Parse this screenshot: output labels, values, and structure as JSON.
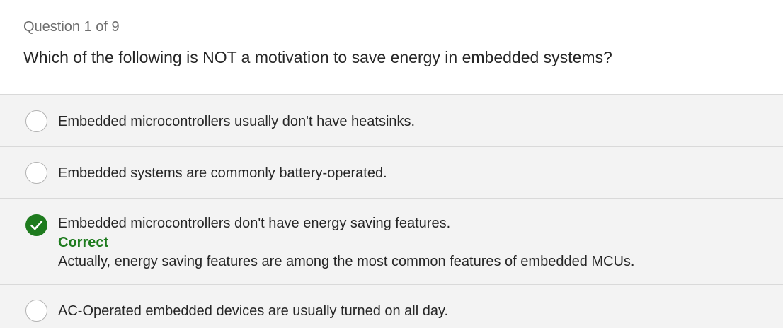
{
  "quiz": {
    "counter": "Question 1 of 9",
    "question": "Which of the following is NOT a motivation to save energy in embedded systems?"
  },
  "options": [
    {
      "label": "Embedded microcontrollers usually don't have heatsinks.",
      "selected": false
    },
    {
      "label": "Embedded systems are commonly battery-operated.",
      "selected": false
    },
    {
      "label": "Embedded microcontrollers don't have energy saving features.",
      "selected": true,
      "status": "Correct",
      "feedback": "Actually, energy saving features are among the most common features of embedded MCUs."
    },
    {
      "label": "AC-Operated embedded devices are usually turned on all day.",
      "selected": false
    }
  ],
  "icons": {
    "selected": "checkmark-icon",
    "unselected": "radio-circle-icon"
  },
  "colors": {
    "correct": "#1e7b1e",
    "option_background": "#f3f3f3"
  }
}
